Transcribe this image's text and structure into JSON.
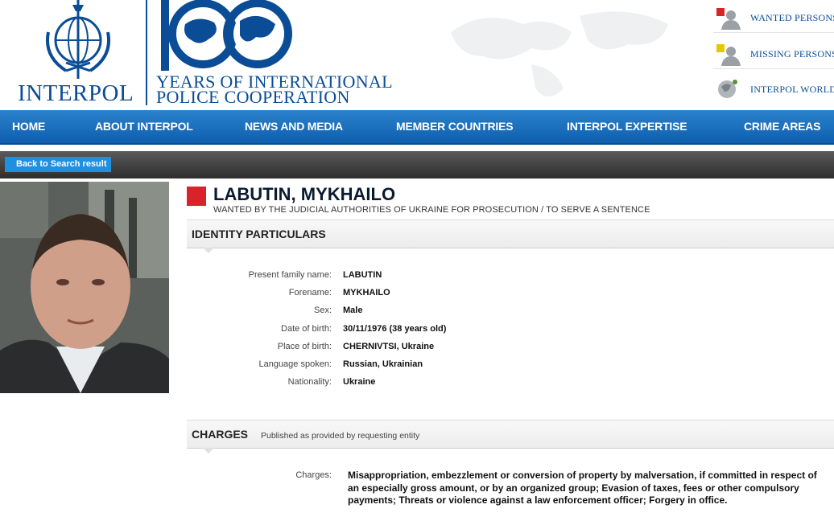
{
  "header": {
    "brand": "INTERPOL",
    "tagline_line1": "YEARS OF INTERNATIONAL",
    "tagline_line2": "POLICE COOPERATION",
    "quick_links": [
      {
        "label": "WANTED PERSONS",
        "icon": "wanted-person-icon"
      },
      {
        "label": "MISSING PERSONS",
        "icon": "missing-person-icon"
      },
      {
        "label": "INTERPOL WORLDW",
        "icon": "globe-icon"
      }
    ]
  },
  "nav": {
    "items": [
      "HOME",
      "ABOUT INTERPOL",
      "NEWS AND MEDIA",
      "MEMBER COUNTRIES",
      "INTERPOL EXPERTISE",
      "CRIME AREAS"
    ]
  },
  "back_button": "Back to Search result",
  "notice": {
    "name": "LABUTIN, MYKHAILO",
    "subtitle": "WANTED BY THE JUDICIAL AUTHORITIES OF UKRAINE FOR PROSECUTION / TO SERVE A SENTENCE",
    "badge_color": "#d8232a"
  },
  "identity": {
    "title": "IDENTITY PARTICULARS",
    "fields": [
      {
        "label": "Present family name:",
        "value": "LABUTIN"
      },
      {
        "label": "Forename:",
        "value": "MYKHAILO"
      },
      {
        "label": "Sex:",
        "value": "Male"
      },
      {
        "label": "Date of birth:",
        "value": "30/11/1976 (38 years old)"
      },
      {
        "label": "Place of birth:",
        "value": "CHERNIVTSI, Ukraine"
      },
      {
        "label": "Language spoken:",
        "value": "Russian, Ukrainian"
      },
      {
        "label": "Nationality:",
        "value": "Ukraine"
      }
    ]
  },
  "charges": {
    "title": "CHARGES",
    "note": "Published as provided by requesting entity",
    "label": "Charges:",
    "text": "Misappropriation, embezzlement or conversion of property by malversation, if committed in respect of an especially gross amount, or by an organized group; Evasion of taxes, fees or other compulsory payments; Threats or violence against a law enforcement officer; Forgery in office."
  },
  "colors": {
    "nav_blue": "#1a6fbd",
    "brand_blue": "#0a4d96",
    "back_button_blue": "#1f8fe0",
    "strip_dark": "#3a3a3a"
  }
}
